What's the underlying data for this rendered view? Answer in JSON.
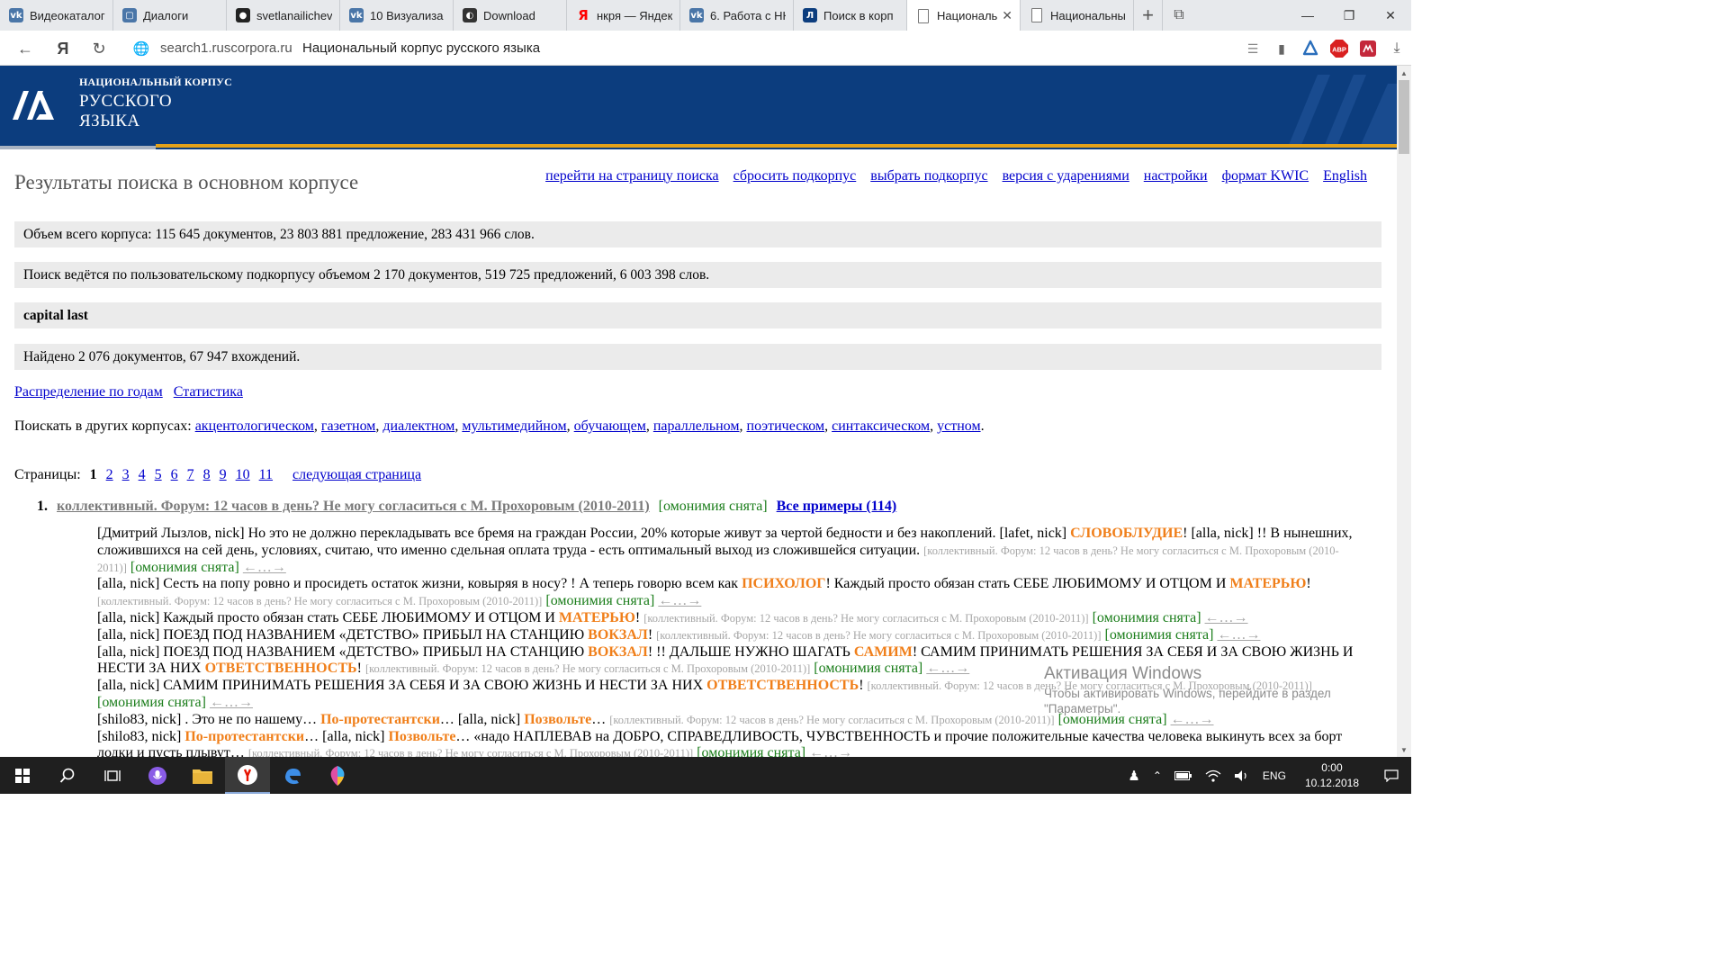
{
  "browser": {
    "tabs": [
      {
        "title": "Видеокаталог",
        "favicon": "vk-icon",
        "color": "#4a76a8",
        "glyph": "vk"
      },
      {
        "title": "Диалоги",
        "favicon": "dialogs-icon",
        "color": "#4a76a8",
        "glyph": "▢"
      },
      {
        "title": "svetlanailichev",
        "favicon": "github-icon",
        "color": "#222222",
        "glyph": "●"
      },
      {
        "title": "10 Визуализа",
        "favicon": "vk-icon",
        "color": "#4a76a8",
        "glyph": "vk"
      },
      {
        "title": "Download",
        "favicon": "download-site-icon",
        "color": "#333333",
        "glyph": "◐"
      },
      {
        "title": "нкря — Яндекс",
        "favicon": "yandex-icon",
        "color": "#ff0000",
        "glyph": "Я"
      },
      {
        "title": "6. Работа с НК",
        "favicon": "vk-icon",
        "color": "#4a76a8",
        "glyph": "vk"
      },
      {
        "title": "Поиск в корп",
        "favicon": "ruscorpora-icon",
        "color": "#0c3d7e",
        "glyph": "Л"
      },
      {
        "title": "Национальн",
        "favicon": "page-icon",
        "color": "#ffffff",
        "glyph": "",
        "active": true
      },
      {
        "title": "Национальны",
        "favicon": "page-icon",
        "color": "#ffffff",
        "glyph": ""
      }
    ],
    "address": {
      "host": "search1.ruscorpora.ru",
      "title": "Национальный корпус русского языка"
    }
  },
  "site": {
    "logo": {
      "line1": "НАЦИОНАЛЬНЫЙ КОРПУС",
      "line2": "РУССКОГО",
      "line3": "ЯЗЫКА"
    },
    "page_title": "Результаты поиска в основном корпусе",
    "top_links": [
      "перейти на страницу поиска",
      "сбросить подкорпус",
      "выбрать подкорпус",
      "версия с ударениями",
      "настройки",
      "формат KWIC",
      "English"
    ],
    "info": {
      "corpus_size": "Объем всего корпуса: 115 645 документов, 23 803 881 предложение, 283 431 966 слов.",
      "subcorpus": "Поиск ведётся по пользовательскому подкорпусу объемом 2 170 документов, 519 725 предложений, 6 003 398 слов.",
      "query": "capital last",
      "found": "Найдено 2 076 документов, 67 947 вхождений."
    },
    "stat_links": [
      "Распределение по годам",
      "Статистика"
    ],
    "other_corpora_label": "Поискать в других корпусах:",
    "other_corpora": [
      "акцентологическом",
      "газетном",
      "диалектном",
      "мультимедийном",
      "обучающем",
      "параллельном",
      "поэтическом",
      "синтаксическом",
      "устном"
    ],
    "pages_label": "Страницы:",
    "current_page": "1",
    "pages": [
      "2",
      "3",
      "4",
      "5",
      "6",
      "7",
      "8",
      "9",
      "10",
      "11"
    ],
    "next_page": "следующая страница",
    "doc": {
      "number": "1.",
      "title": "коллективный. Форум: 12 часов в день? Не могу согласиться с М. Прохоровым (2010-2011)",
      "homonymy": "[омонимия снята]",
      "all_examples": "Все примеры (114)"
    },
    "source_label": "[коллективный. Форум: 12 часов в день? Не могу согласиться с М. Прохоровым (2010-2011)]",
    "omon_label": "[омонимия снята]",
    "nav_label": "←…→",
    "examples": [
      {
        "t1": "[Дмитрий Лызлов, nick] Но это не должно перекладывать все бремя на граждан России, 20% которые живут за чертой бедности и без накоплений. [lafet, nick] ",
        "h1": "СЛОВОБЛУДИЕ",
        "t2": "! [alla, nick] !! В нынешних, сложившихся на сей день, условиях, считаю, что именно сдельная оплата труда - есть оптимальный выход из сложившейся ситуации. ",
        "h2": "",
        "t3": ""
      },
      {
        "t1": "[alla, nick] Сесть на попу ровно и просидеть остаток жизни, ковыряя в носу? ! А теперь говорю всем как ",
        "h1": "ПСИХОЛОГ",
        "t2": "! Каждый просто обязан стать СЕБЕ ЛЮБИМОМУ И ОТЦОМ И ",
        "h2": "МАТЕРЬЮ",
        "t3": "! "
      },
      {
        "t1": "[alla, nick] Каждый просто обязан стать СЕБЕ ЛЮБИМОМУ И ОТЦОМ И ",
        "h1": "МАТЕРЬЮ",
        "t2": "! ",
        "h2": "",
        "t3": ""
      },
      {
        "t1": "[alla, nick] ПОЕЗД ПОД НАЗВАНИЕМ «ДЕТСТВО» ПРИБЫЛ НА СТАНЦИЮ ",
        "h1": "ВОКЗАЛ",
        "t2": "! ",
        "h2": "",
        "t3": ""
      },
      {
        "t1": "[alla, nick] ПОЕЗД ПОД НАЗВАНИЕМ «ДЕТСТВО» ПРИБЫЛ НА СТАНЦИЮ ",
        "h1": "ВОКЗАЛ",
        "t2": "! !! ДАЛЬШЕ НУЖНО ШАГАТЬ ",
        "h2": "САМИМ",
        "t3": "! САМИМ ПРИНИМАТЬ РЕШЕНИЯ ЗА СЕБЯ И ЗА СВОЮ ЖИЗНЬ И НЕСТИ ЗА НИХ ",
        "h3": "ОТВЕТСТВЕННОСТЬ",
        "t4": "! "
      },
      {
        "t1": "[alla, nick] САМИМ ПРИНИМАТЬ РЕШЕНИЯ ЗА СЕБЯ И ЗА СВОЮ ЖИЗНЬ И НЕСТИ ЗА НИХ ",
        "h1": "ОТВЕТСТВЕННОСТЬ",
        "t2": "! ",
        "h2": "",
        "t3": ""
      },
      {
        "t1": "[shilo83, nick] . Это не по нашему… ",
        "h1": "По-протестантски",
        "t2": "… [alla, nick] ",
        "h2": "Позвольте",
        "t3": "… "
      },
      {
        "t1": "[shilo83, nick] ",
        "h1": "По-протестантски",
        "t2": "… [alla, nick] ",
        "h2": "Позвольте",
        "t3": "… «надо НАПЛЕВАВ на ДОБРО, СПРАВЕДЛИВОСТЬ, ЧУВСТВЕННОСТЬ и прочие положительные качества человека выкинуть всех за борт лодки и пусть плывут… "
      }
    ],
    "watermark": {
      "title": "Активация Windows",
      "text": "Чтобы активировать Windows, перейдите в раздел \"Параметры\"."
    }
  },
  "taskbar": {
    "lang": "ENG",
    "time": "0:00",
    "date": "10.12.2018"
  }
}
